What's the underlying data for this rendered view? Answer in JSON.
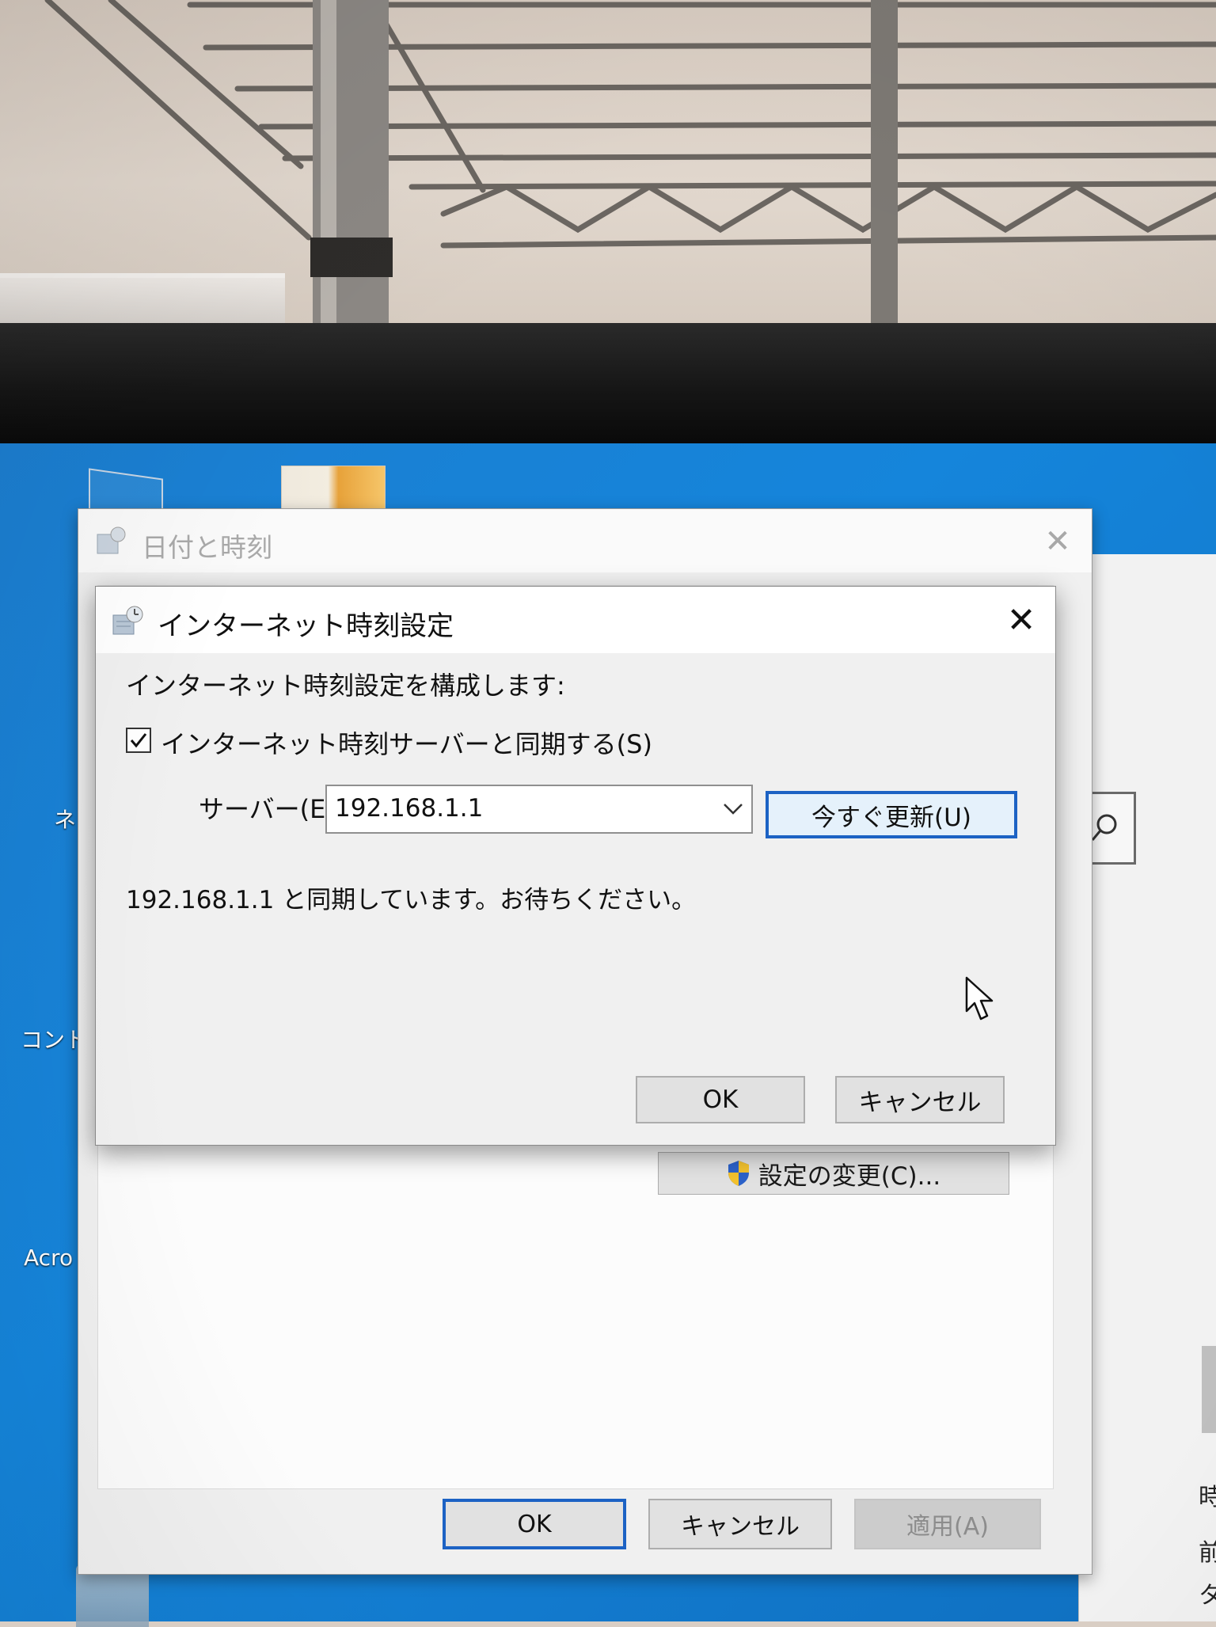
{
  "environment": {
    "desktop_labels": [
      "ネ",
      "コント",
      "Acro"
    ],
    "right_window_glyphs": [
      "時",
      "前",
      "タ"
    ]
  },
  "back_dialog": {
    "title": "日付と時刻",
    "change_settings_label": "設定の変更(C)...",
    "ok_label": "OK",
    "cancel_label": "キャンセル",
    "apply_label": "適用(A)"
  },
  "dialog": {
    "title": "インターネット時刻設定",
    "heading": "インターネット時刻設定を構成します:",
    "sync_checkbox_label": "インターネット時刻サーバーと同期する(S)",
    "sync_checked": true,
    "server_label": "サーバー(E):",
    "server_value": "192.168.1.1",
    "update_now_label": "今すぐ更新(U)",
    "status_message": "192.168.1.1 と同期しています。お待ちください。",
    "ok_label": "OK",
    "cancel_label": "キャンセル"
  },
  "colors": {
    "accent": "#1c62c4",
    "desktop": "#1585db",
    "dialog_bg": "#f0f0f0"
  },
  "icons": [
    "clock-globe-icon",
    "close-icon",
    "checkmark-icon",
    "chevron-down-icon",
    "uac-shield-icon",
    "mouse-cursor-icon",
    "search-icon"
  ]
}
